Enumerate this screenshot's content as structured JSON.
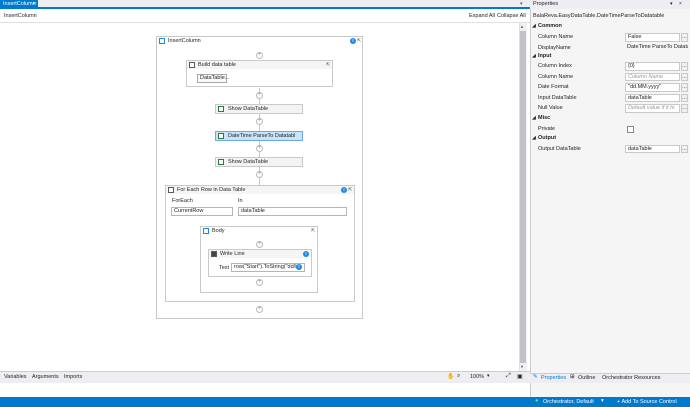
{
  "tab": {
    "title": "InsertColumn"
  },
  "breadcrumb": "InsertColumn",
  "toolbar": {
    "expand_all": "Expand All",
    "collapse_all": "Collapse All"
  },
  "workflow": {
    "sequence_title": "InsertColumn",
    "build_data_table": {
      "title": "Build data table",
      "button": "DataTable..."
    },
    "activities": [
      {
        "label": "Show DataTable"
      },
      {
        "label": "DateTime ParseTo Datatabl"
      },
      {
        "label": "Show DataTable"
      }
    ],
    "foreach": {
      "title": "For Each Row in Data Table",
      "foreach_label": "ForEach",
      "foreach_value": "CurrentRow",
      "in_label": "In",
      "in_value": "dataTable",
      "body_title": "Body",
      "write_line": {
        "title": "Write Line",
        "text_label": "Text",
        "text_value": "row(\"Start\").ToString(\"dd/I"
      }
    }
  },
  "bottom": {
    "variables": "Variables",
    "arguments": "Arguments",
    "imports": "Imports",
    "zoom": "100%"
  },
  "properties": {
    "panel_title": "Properties",
    "type_name": "BalaReva.EasyDataTable.DateTimeParseToDatatable",
    "categories": {
      "common": "Common",
      "input": "Input",
      "misc": "Misc",
      "output": "Output"
    },
    "common": [
      {
        "key": "Column Name",
        "value": "False"
      },
      {
        "key": "DisplayName",
        "value": "DateTime ParseTo Datata"
      }
    ],
    "input": [
      {
        "key": "Column Index",
        "value": "{0}"
      },
      {
        "key": "Column Name",
        "value": "Column Name",
        "placeholder": true
      },
      {
        "key": "Date Format",
        "value": "\"dd.MM.yyyy\""
      },
      {
        "key": "Input DataTable",
        "value": "dataTable"
      },
      {
        "key": "Null Value",
        "value": "Default value if it hi",
        "placeholder": true
      }
    ],
    "misc": [
      {
        "key": "Private"
      }
    ],
    "output": [
      {
        "key": "Output DataTable",
        "value": "dataTable"
      }
    ],
    "tabs": [
      "Properties",
      "Outline",
      "Orchestrator Resources"
    ]
  },
  "status": {
    "orchestrator": "Orchestrator, Default",
    "source_control": "Add To Source Control"
  },
  "colors": {
    "accent": "#007acc",
    "selected": "#c9e3f8"
  }
}
